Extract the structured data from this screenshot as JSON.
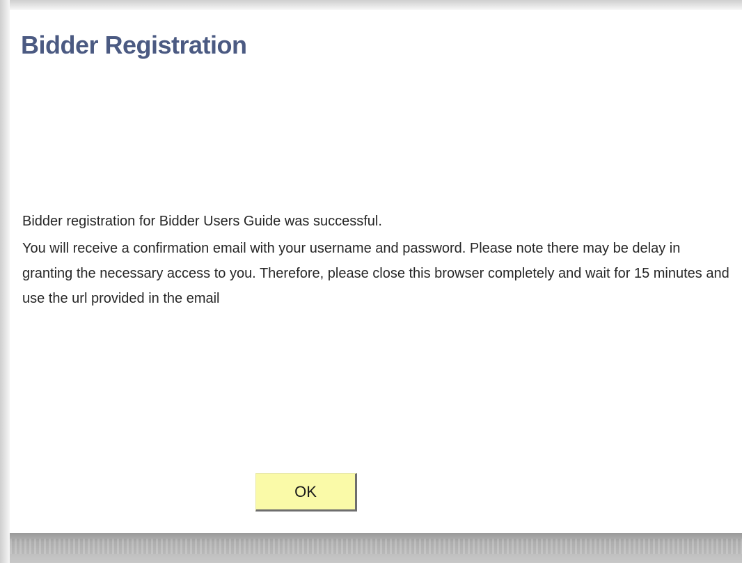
{
  "page": {
    "title": "Bidder Registration"
  },
  "message": {
    "success_line": "Bidder registration for Bidder Users Guide was successful.",
    "details": "You will receive a confirmation email with your username and password.  Please note there may be delay in granting the necessary access to you.  Therefore, please close this browser completely and wait for 15 minutes and use the url provided in the email"
  },
  "actions": {
    "ok_label": "OK"
  },
  "colors": {
    "title": "#4b5a82",
    "button_background": "#fafaa8",
    "text": "#262626"
  }
}
